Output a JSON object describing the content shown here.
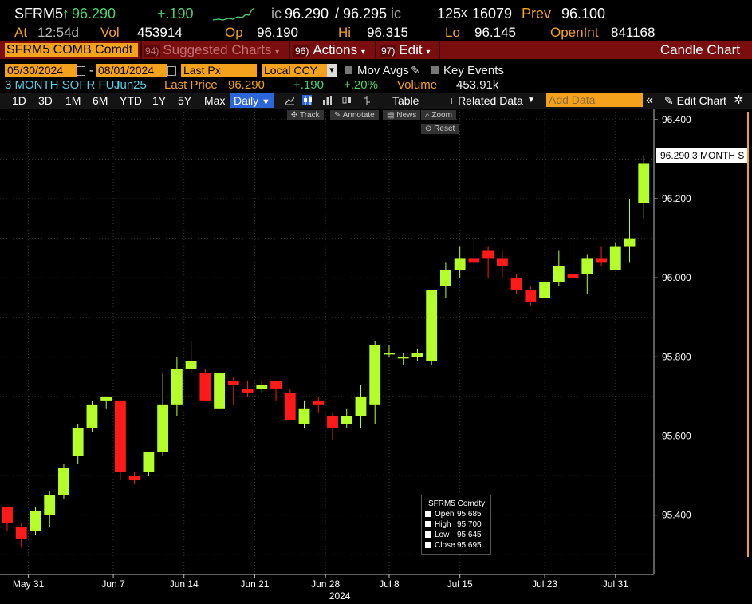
{
  "quote": {
    "ticker": "SFRM5",
    "arrow": "↑",
    "last": "96.290",
    "change": "+.190",
    "bid_prefix": "ic",
    "bid": "96.290",
    "ask_sep": "/",
    "ask": "96.295",
    "ask_suffix": "ic",
    "size_bid": "125",
    "size_x": "x",
    "size_ask": "16079",
    "prev_label": "Prev",
    "prev": "96.100",
    "at_label": "At",
    "time": "12:54d",
    "vol_label": "Vol",
    "vol": "453914",
    "op_label": "Op",
    "op": "96.190",
    "hi_label": "Hi",
    "hi": "96.315",
    "lo_label": "Lo",
    "lo": "96.145",
    "openint_label": "OpenInt",
    "openint": "841168"
  },
  "menubar": {
    "security": "SFRM5 COMB Comdt",
    "suggested_num": "94)",
    "suggested": "Suggested Charts",
    "actions_num": "96)",
    "actions": "Actions",
    "edit_num": "97)",
    "edit": "Edit",
    "title": "Candle Chart"
  },
  "controls": {
    "start_date": "05/30/2024",
    "dash": "-",
    "end_date": "08/01/2024",
    "field": "Last Px",
    "currency": "Local CCY",
    "mov_avgs": "Mov Avgs",
    "key_events": "Key Events"
  },
  "info": {
    "security_name": "3 MONTH SOFR FUT",
    "contract": "Jun25",
    "last_price_label": "Last Price",
    "last_price": "96.290",
    "change": "+.190",
    "pct_change": "+.20%",
    "volume_label": "Volume",
    "volume": "453.91k"
  },
  "toolbar": {
    "ranges": [
      "1D",
      "3D",
      "1M",
      "6M",
      "YTD",
      "1Y",
      "5Y",
      "Max"
    ],
    "frequency": "Daily",
    "table": "Table",
    "related_data": "+ Related Data",
    "add_data_placeholder": "Add Data",
    "edit_chart": "Edit Chart"
  },
  "chart_tools": {
    "track": "Track",
    "annotate": "Annotate",
    "news": "News",
    "zoom": "Zoom",
    "reset": "Reset"
  },
  "last_price_tag": {
    "value": "96.290",
    "label": "3 MONTH S"
  },
  "legend": {
    "title": "SFRM5 Comdty",
    "rows": [
      {
        "label": "Open",
        "value": "95.685"
      },
      {
        "label": "High",
        "value": "95.700"
      },
      {
        "label": "Low",
        "value": "95.645"
      },
      {
        "label": "Close",
        "value": "95.695"
      }
    ]
  },
  "colors": {
    "up": "#b4ff2a",
    "down": "#ff1a1a",
    "accent": "#f4a21c",
    "menubar": "#7a0d0d"
  },
  "chart_data": {
    "type": "candlestick",
    "ylim": [
      95.25,
      96.42
    ],
    "yticks": [
      "96.400",
      "96.200",
      "96.000",
      "95.800",
      "95.600",
      "95.400"
    ],
    "xticks": [
      "May 31",
      "Jun 7",
      "Jun 14",
      "Jun 21",
      "Jun 28",
      "Jul 8",
      "Jul 15",
      "Jul 23",
      "Jul 31"
    ],
    "xtick_index": [
      1.5,
      7.5,
      12.5,
      17.5,
      22.5,
      27,
      32,
      38,
      43
    ],
    "year_label": "2024",
    "candles": [
      {
        "o": 95.42,
        "h": 95.42,
        "l": 95.36,
        "c": 95.38
      },
      {
        "o": 95.37,
        "h": 95.38,
        "l": 95.32,
        "c": 95.34
      },
      {
        "o": 95.36,
        "h": 95.42,
        "l": 95.35,
        "c": 95.41
      },
      {
        "o": 95.4,
        "h": 95.46,
        "l": 95.37,
        "c": 95.45
      },
      {
        "o": 95.45,
        "h": 95.53,
        "l": 95.44,
        "c": 95.52
      },
      {
        "o": 95.55,
        "h": 95.63,
        "l": 95.53,
        "c": 95.62
      },
      {
        "o": 95.62,
        "h": 95.69,
        "l": 95.61,
        "c": 95.68
      },
      {
        "o": 95.69,
        "h": 95.7,
        "l": 95.67,
        "c": 95.7
      },
      {
        "o": 95.69,
        "h": 95.69,
        "l": 95.49,
        "c": 95.51
      },
      {
        "o": 95.5,
        "h": 95.51,
        "l": 95.48,
        "c": 95.49
      },
      {
        "o": 95.51,
        "h": 95.56,
        "l": 95.5,
        "c": 95.56
      },
      {
        "o": 95.56,
        "h": 95.76,
        "l": 95.55,
        "c": 95.68
      },
      {
        "o": 95.68,
        "h": 95.8,
        "l": 95.65,
        "c": 95.77
      },
      {
        "o": 95.77,
        "h": 95.84,
        "l": 95.76,
        "c": 95.79
      },
      {
        "o": 95.76,
        "h": 95.77,
        "l": 95.69,
        "c": 95.69
      },
      {
        "o": 95.67,
        "h": 95.76,
        "l": 95.67,
        "c": 95.76
      },
      {
        "o": 95.74,
        "h": 95.75,
        "l": 95.68,
        "c": 95.73
      },
      {
        "o": 95.72,
        "h": 95.74,
        "l": 95.7,
        "c": 95.71
      },
      {
        "o": 95.72,
        "h": 95.74,
        "l": 95.71,
        "c": 95.73
      },
      {
        "o": 95.74,
        "h": 95.74,
        "l": 95.69,
        "c": 95.72
      },
      {
        "o": 95.71,
        "h": 95.72,
        "l": 95.64,
        "c": 95.64
      },
      {
        "o": 95.63,
        "h": 95.69,
        "l": 95.62,
        "c": 95.67
      },
      {
        "o": 95.69,
        "h": 95.7,
        "l": 95.66,
        "c": 95.68
      },
      {
        "o": 95.65,
        "h": 95.66,
        "l": 95.59,
        "c": 95.62
      },
      {
        "o": 95.63,
        "h": 95.67,
        "l": 95.62,
        "c": 95.65
      },
      {
        "o": 95.65,
        "h": 95.73,
        "l": 95.62,
        "c": 95.7
      },
      {
        "o": 95.68,
        "h": 95.84,
        "l": 95.63,
        "c": 95.83
      },
      {
        "o": 95.81,
        "h": 95.83,
        "l": 95.8,
        "c": 95.81
      },
      {
        "o": 95.8,
        "h": 95.81,
        "l": 95.78,
        "c": 95.8
      },
      {
        "o": 95.8,
        "h": 95.82,
        "l": 95.79,
        "c": 95.81
      },
      {
        "o": 95.79,
        "h": 95.97,
        "l": 95.78,
        "c": 95.97
      },
      {
        "o": 95.98,
        "h": 96.04,
        "l": 95.95,
        "c": 96.02
      },
      {
        "o": 96.02,
        "h": 96.08,
        "l": 96.0,
        "c": 96.05
      },
      {
        "o": 96.05,
        "h": 96.09,
        "l": 96.02,
        "c": 96.04
      },
      {
        "o": 96.07,
        "h": 96.08,
        "l": 96.0,
        "c": 96.05
      },
      {
        "o": 96.05,
        "h": 96.07,
        "l": 96.0,
        "c": 96.03
      },
      {
        "o": 96.0,
        "h": 96.01,
        "l": 95.96,
        "c": 95.97
      },
      {
        "o": 95.97,
        "h": 95.98,
        "l": 95.93,
        "c": 95.94
      },
      {
        "o": 95.95,
        "h": 95.99,
        "l": 95.95,
        "c": 95.99
      },
      {
        "o": 95.99,
        "h": 96.07,
        "l": 95.98,
        "c": 96.03
      },
      {
        "o": 96.01,
        "h": 96.12,
        "l": 96.0,
        "c": 96.0
      },
      {
        "o": 96.01,
        "h": 96.06,
        "l": 95.96,
        "c": 96.05
      },
      {
        "o": 96.05,
        "h": 96.08,
        "l": 96.03,
        "c": 96.04
      },
      {
        "o": 96.02,
        "h": 96.09,
        "l": 96.02,
        "c": 96.08
      },
      {
        "o": 96.08,
        "h": 96.2,
        "l": 96.04,
        "c": 96.1
      },
      {
        "o": 96.19,
        "h": 96.31,
        "l": 96.15,
        "c": 96.29
      }
    ]
  }
}
